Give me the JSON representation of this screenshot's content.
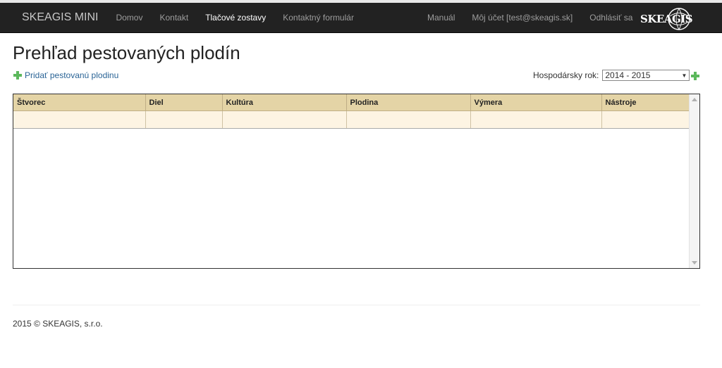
{
  "nav": {
    "brand": "SKEAGIS MINI",
    "items": [
      "Domov",
      "Kontakt",
      "Tlačové zostavy",
      "Kontaktný formulár"
    ],
    "right_items": [
      "Manuál",
      "Môj účet [test@skeagis.sk]",
      "Odhlásiť sa"
    ],
    "logo_text": "SKEAGIS"
  },
  "page": {
    "title": "Prehľad pestovaných plodín",
    "add_link": "Pridať pestovanú plodinu",
    "season_label": "Hospodársky rok:",
    "season_value": "2014 - 2015"
  },
  "table": {
    "columns": [
      "Štvorec",
      "Diel",
      "Kultúra",
      "Plodina",
      "Výmera",
      "Nástroje"
    ],
    "rows": [
      [
        "",
        "",
        "",
        "",
        "",
        ""
      ]
    ]
  },
  "footer": {
    "text": "2015 © SKEAGIS, s.r.o."
  },
  "colors": {
    "navbar": "#222222",
    "header": "#e4d4a6",
    "row": "#fdf4e3",
    "plus": "#5cb85c"
  }
}
